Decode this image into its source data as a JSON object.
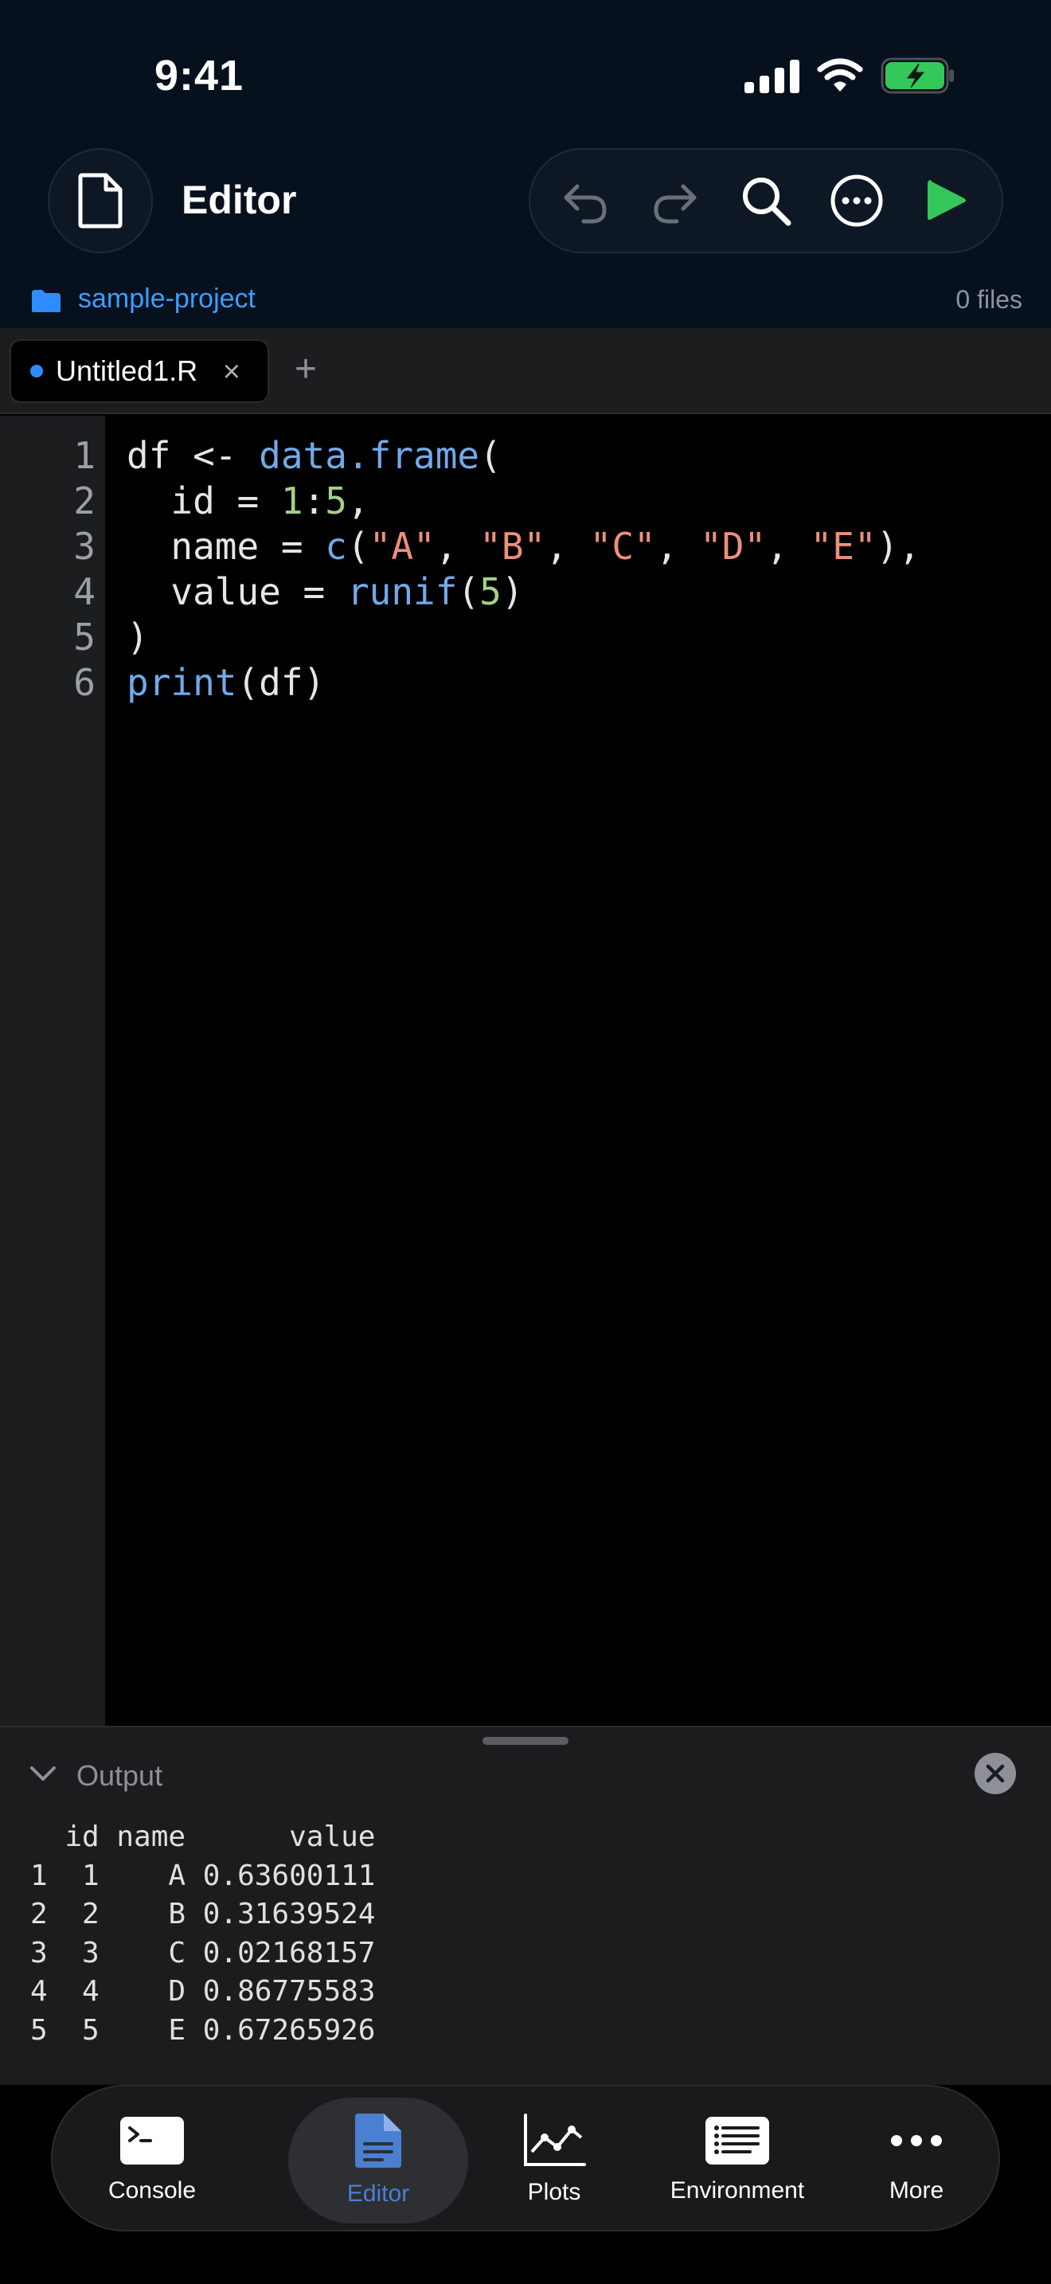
{
  "status": {
    "time": "9:41"
  },
  "header": {
    "title": "Editor"
  },
  "project": {
    "name": "sample-project",
    "file_count": "0 files"
  },
  "tabs": [
    {
      "label": "Untitled1.R",
      "close": "×"
    }
  ],
  "tab_add": "+",
  "editor": {
    "line_numbers": [
      "1",
      "2",
      "3",
      "4",
      "5",
      "6"
    ],
    "lines": [
      [
        {
          "t": "df <- ",
          "c": ""
        },
        {
          "t": "data.frame",
          "c": "kw"
        },
        {
          "t": "(",
          "c": ""
        }
      ],
      [
        {
          "t": "  id = ",
          "c": ""
        },
        {
          "t": "1",
          "c": "num"
        },
        {
          "t": ":",
          "c": ""
        },
        {
          "t": "5",
          "c": "num"
        },
        {
          "t": ",",
          "c": ""
        }
      ],
      [
        {
          "t": "  name = ",
          "c": ""
        },
        {
          "t": "c",
          "c": "kw"
        },
        {
          "t": "(",
          "c": ""
        },
        {
          "t": "\"A\"",
          "c": "str"
        },
        {
          "t": ", ",
          "c": ""
        },
        {
          "t": "\"B\"",
          "c": "str"
        },
        {
          "t": ", ",
          "c": ""
        },
        {
          "t": "\"C\"",
          "c": "str"
        },
        {
          "t": ", ",
          "c": ""
        },
        {
          "t": "\"D\"",
          "c": "str"
        },
        {
          "t": ", ",
          "c": ""
        },
        {
          "t": "\"E\"",
          "c": "str"
        },
        {
          "t": "),",
          "c": ""
        }
      ],
      [
        {
          "t": "  value = ",
          "c": ""
        },
        {
          "t": "runif",
          "c": "kw"
        },
        {
          "t": "(",
          "c": ""
        },
        {
          "t": "5",
          "c": "num"
        },
        {
          "t": ")",
          "c": ""
        }
      ],
      [
        {
          "t": ")",
          "c": ""
        }
      ],
      [
        {
          "t": "print",
          "c": "kw"
        },
        {
          "t": "(df)",
          "c": ""
        }
      ]
    ]
  },
  "output": {
    "title": "Output",
    "text": "  id name      value\n1  1    A 0.63600111\n2  2    B 0.31639524\n3  3    C 0.02168157\n4  4    D 0.86775583\n5  5    E 0.67265926"
  },
  "nav": {
    "console": "Console",
    "editor": "Editor",
    "plots": "Plots",
    "environment": "Environment",
    "more": "More"
  },
  "colors": {
    "accent": "#3d9dff",
    "run": "#34c759",
    "battery": "#34c759",
    "keyword": "#72a9ea",
    "number": "#a6d08a",
    "string": "#ee8f7c",
    "nav_active": "#4a7fd1"
  }
}
